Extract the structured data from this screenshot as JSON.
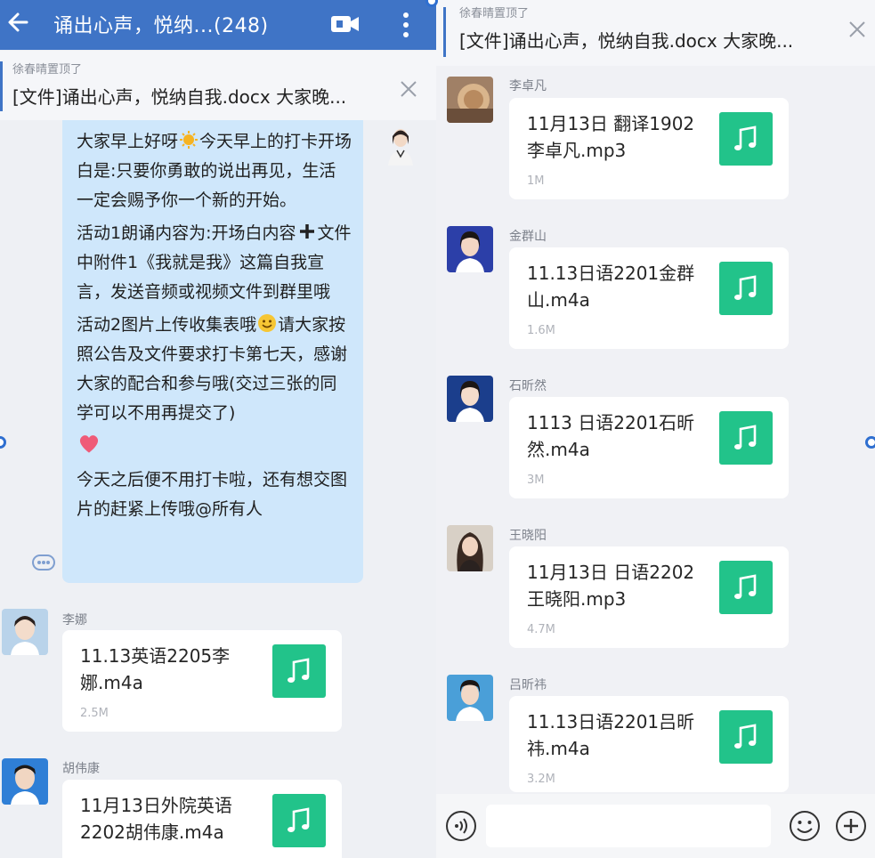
{
  "header": {
    "title": "诵出心声，悦纳...",
    "member_count": "(248)"
  },
  "pinned": {
    "pinned_by": "徐春晴置顶了",
    "text": "[文件]诵出心声，悦纳自我.docx  大家晚..."
  },
  "announcement": {
    "paragraphs": [
      {
        "before": "大家早上好呀",
        "emoji": "sun",
        "after": "今天早上的打卡开场白是:只要你勇敢的说出再见，生活一定会赐予你一个新的开始。"
      },
      {
        "before": "活动1朗诵内容为:开场白内容",
        "emoji": "plus",
        "after": "文件中附件1《我就是我》这篇自我宣言，发送音频或视频文件到群里哦"
      },
      {
        "before": "活动2图片上传收集表哦",
        "emoji": "smiley",
        "after": "请大家按照公告及文件要求打卡第七天，感谢大家的配合和参与哦(交过三张的同学可以不用再提交了)"
      },
      {
        "before": "",
        "emoji": "heart",
        "after": ""
      },
      {
        "before": "今天之后便不用打卡啦，还有想交图片的赶紧上传哦@所有人",
        "emoji": "",
        "after": ""
      }
    ]
  },
  "left_messages": [
    {
      "sender": "李娜",
      "file_name": "11.13英语2205李娜.m4a",
      "file_size": "2.5M",
      "avatar_bg": "#b9d3ea"
    },
    {
      "sender": "胡伟康",
      "file_name": "11月13日外院英语2202胡伟康.m4a",
      "file_size": "",
      "avatar_bg": "#2f7fd6"
    }
  ],
  "right_messages": [
    {
      "sender": "李卓凡",
      "file_name": "11月13日 翻译1902李卓凡.mp3",
      "file_size": "1M",
      "avatar_bg": "#a08066"
    },
    {
      "sender": "金群山",
      "file_name": "11.13日语2201金群山.m4a",
      "file_size": "1.6M",
      "avatar_bg": "#2c3fa8"
    },
    {
      "sender": "石昕然",
      "file_name": "1113 日语2201石昕然.m4a",
      "file_size": "3M",
      "avatar_bg": "#1b3e8c"
    },
    {
      "sender": "王晓阳",
      "file_name": "11月13日  日语2202王晓阳.mp3",
      "file_size": "4.7M",
      "avatar_bg": "#d8d0c6"
    },
    {
      "sender": "吕昕祎",
      "file_name": "11.13日语2201吕昕祎.m4a",
      "file_size": "3.2M",
      "avatar_bg": "#4a9fd8"
    }
  ],
  "input": {
    "placeholder": ""
  },
  "colors": {
    "header_blue": "#3f74c6",
    "bubble_blue": "#cfe7fb",
    "file_green": "#22c38a"
  }
}
